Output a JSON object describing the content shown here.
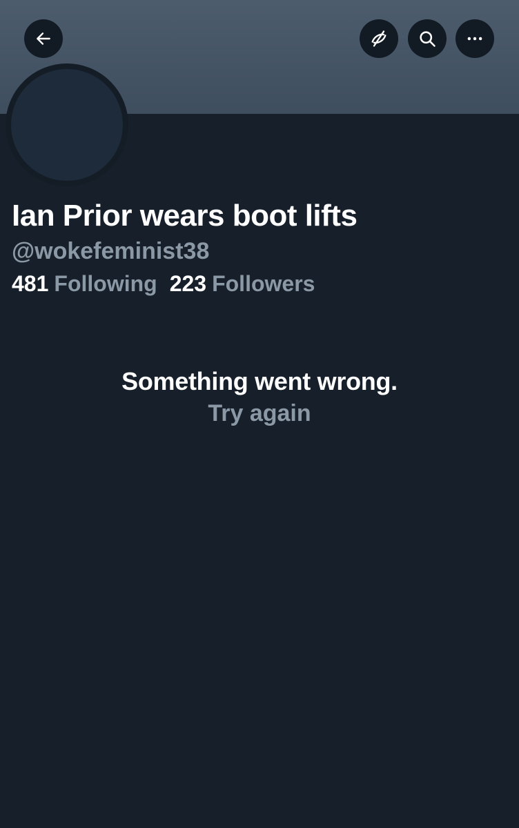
{
  "header": {
    "back_icon": "arrow-left-icon",
    "translate_icon": "translate-off-icon",
    "search_icon": "search-icon",
    "more_icon": "more-horizontal-icon",
    "banner_color": "#44525f",
    "button_bg": "#121a23"
  },
  "profile": {
    "display_name": "Ian Prior wears boot lifts",
    "handle": "@wokefeminist38",
    "following_count": "481",
    "following_label": "Following",
    "followers_count": "223",
    "followers_label": "Followers"
  },
  "error": {
    "message": "Something went wrong.",
    "retry_label": "Try again"
  },
  "colors": {
    "background": "#17202a",
    "primary_text": "#ffffff",
    "secondary_text": "#8b98a5",
    "avatar_fill": "#1e2b3b"
  }
}
